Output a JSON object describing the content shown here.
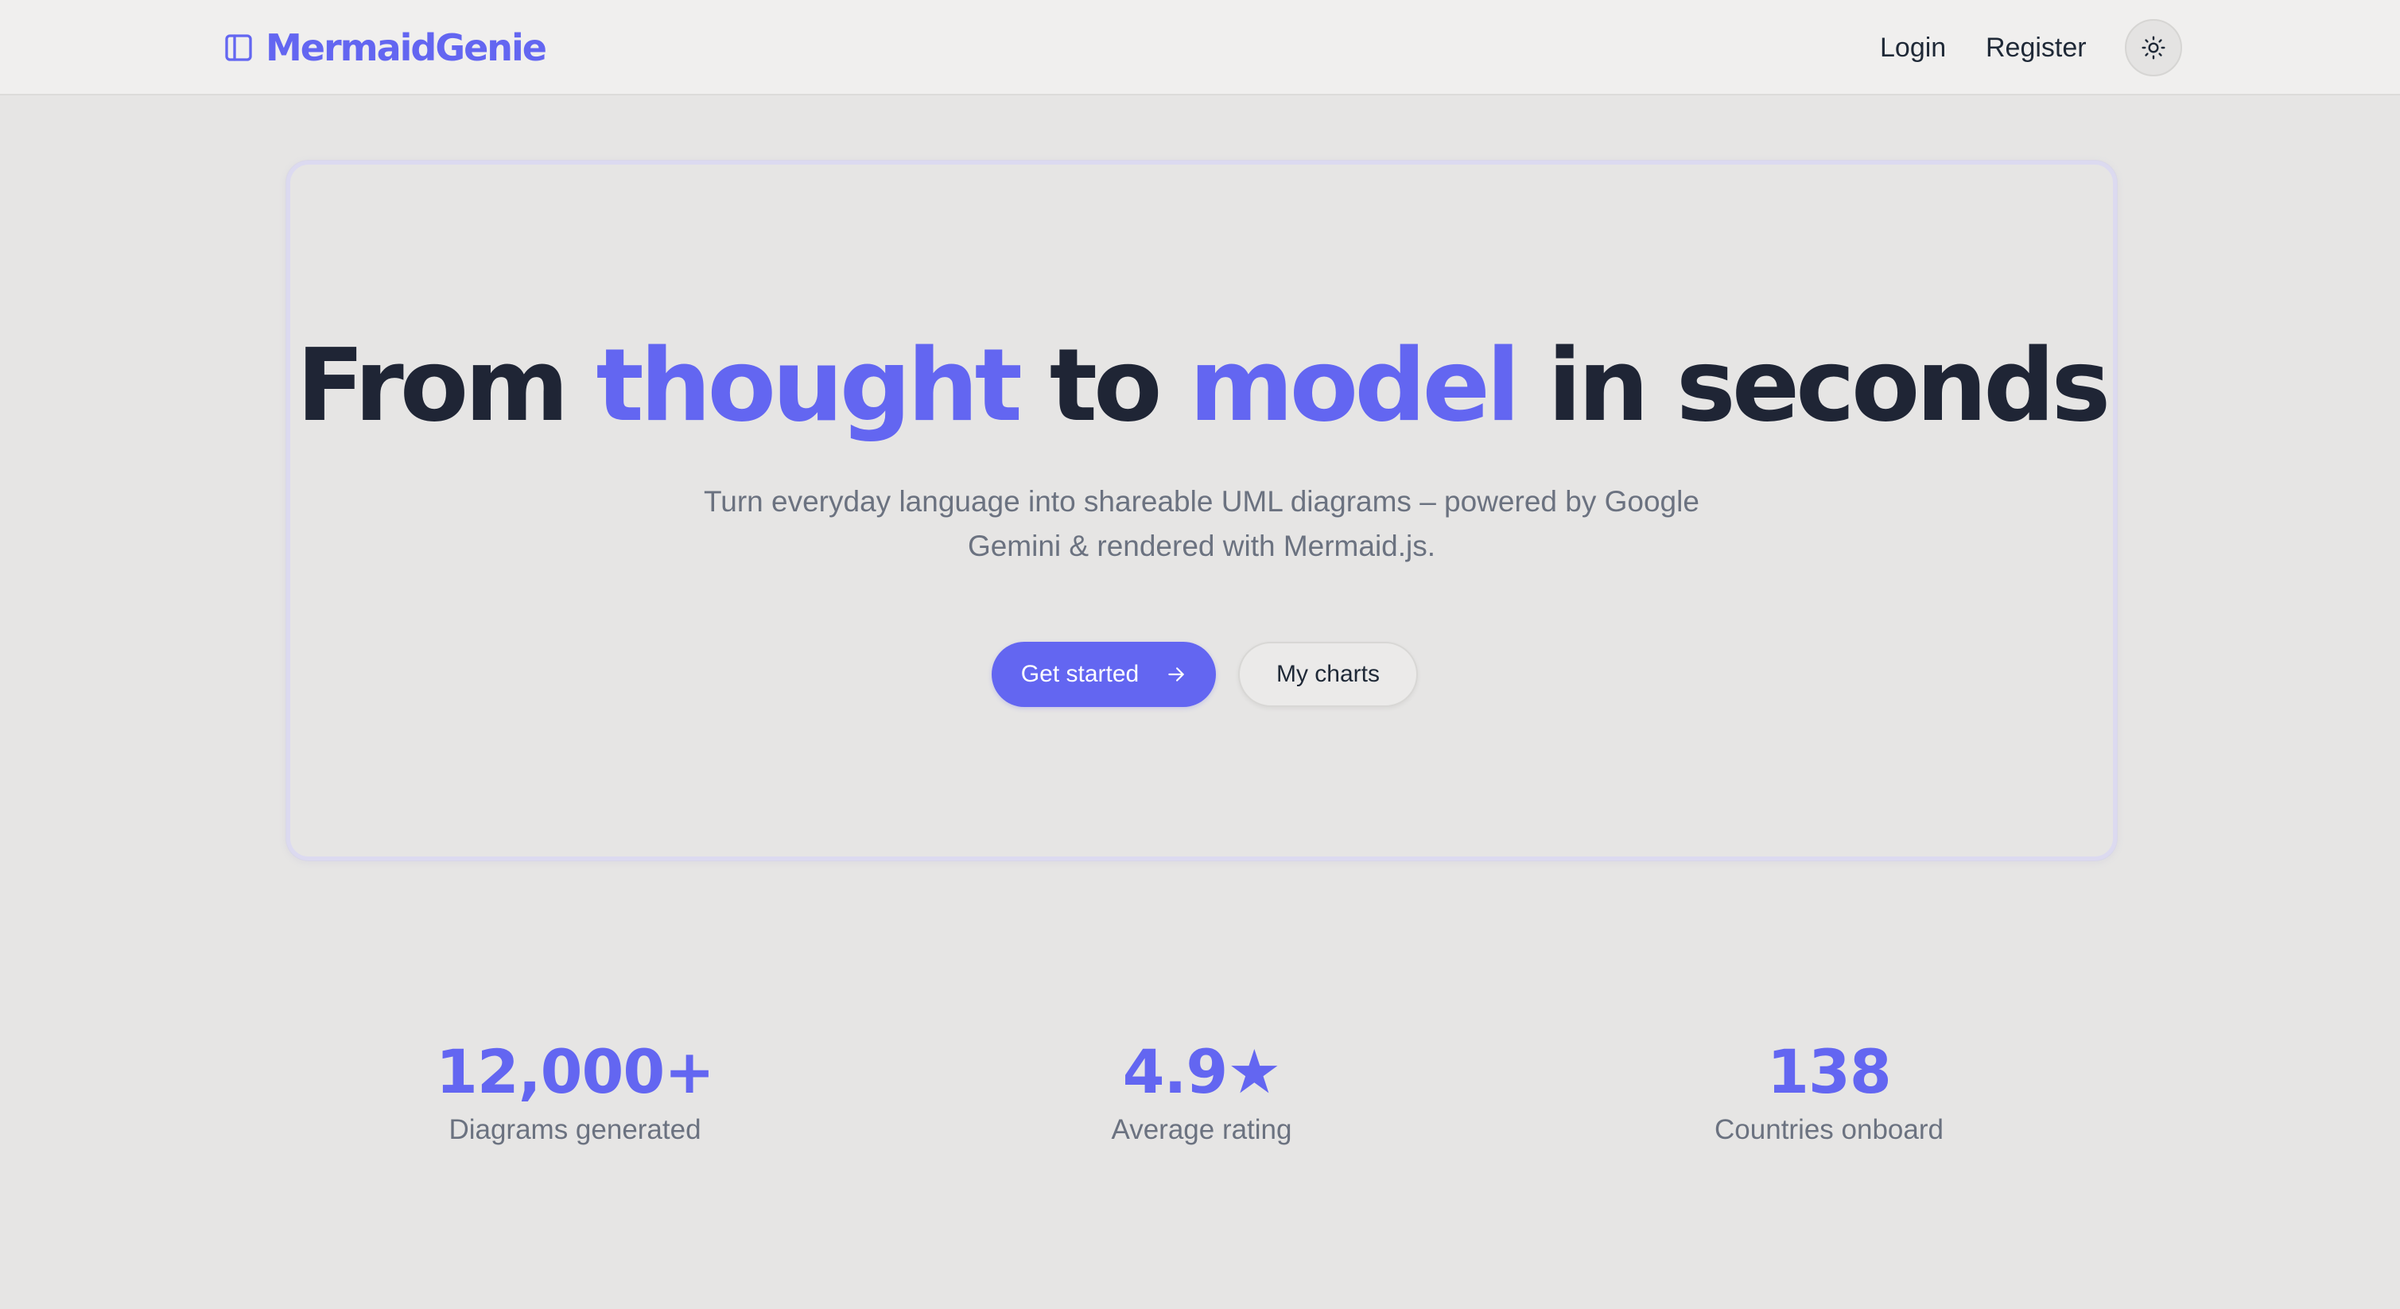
{
  "header": {
    "brand": "MermaidGenie",
    "brand_icon": "sidebar-panel-icon",
    "nav": {
      "login": "Login",
      "register": "Register"
    },
    "theme_toggle_icon": "sun-icon"
  },
  "hero": {
    "title": {
      "part1": "From ",
      "accent1": "thought",
      "part2": " to ",
      "accent2": "model",
      "part3": " in seconds"
    },
    "subtitle": "Turn everyday language into shareable UML diagrams – powered by Google Gemini & rendered with Mermaid.js.",
    "primary_button": "Get started",
    "primary_button_icon": "arrow-right-icon",
    "secondary_button": "My charts"
  },
  "stats": [
    {
      "value": "12,000+",
      "label": "Diagrams generated"
    },
    {
      "value": "4.9★",
      "label": "Average rating"
    },
    {
      "value": "138",
      "label": "Countries onboard"
    }
  ],
  "colors": {
    "accent": "#6366f1",
    "heading": "#1f2535",
    "muted_text": "#6b7280",
    "background": "#e6e5e4",
    "header_background": "#f0efee"
  }
}
